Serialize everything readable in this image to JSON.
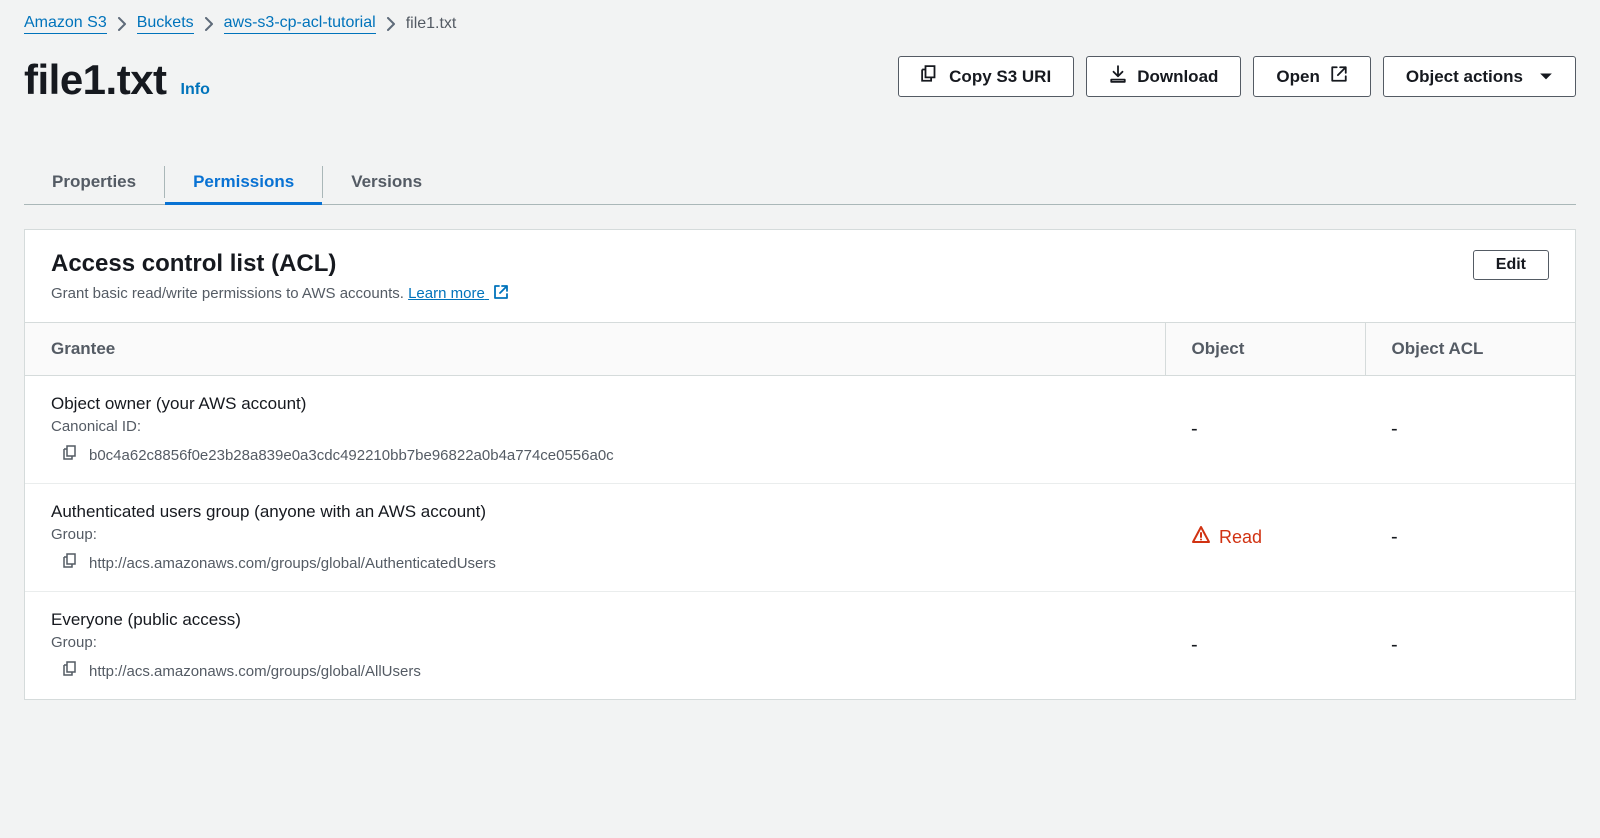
{
  "breadcrumb": {
    "items": [
      {
        "label": "Amazon S3",
        "href": true
      },
      {
        "label": "Buckets",
        "href": true
      },
      {
        "label": "aws-s3-cp-acl-tutorial",
        "href": true
      },
      {
        "label": "file1.txt",
        "href": false
      }
    ]
  },
  "header": {
    "title": "file1.txt",
    "info": "Info"
  },
  "actions": {
    "copy_uri": "Copy S3 URI",
    "download": "Download",
    "open": "Open",
    "object_actions": "Object actions"
  },
  "tabs": {
    "properties": "Properties",
    "permissions": "Permissions",
    "versions": "Versions",
    "active": "permissions"
  },
  "acl_panel": {
    "title": "Access control list (ACL)",
    "desc": "Grant basic read/write permissions to AWS accounts.",
    "learn_more": "Learn more",
    "edit": "Edit",
    "columns": {
      "grantee": "Grantee",
      "object": "Object",
      "object_acl": "Object ACL"
    },
    "rows": [
      {
        "title": "Object owner (your AWS account)",
        "sub": "Canonical ID:",
        "value": "b0c4a62c8856f0e23b28a839e0a3cdc492210bb7be96822a0b4a774ce0556a0c",
        "object": "-",
        "object_acl": "-"
      },
      {
        "title": "Authenticated users group (anyone with an AWS account)",
        "sub": "Group:",
        "value": "http://acs.amazonaws.com/groups/global/AuthenticatedUsers",
        "object": "Read",
        "object_warn": true,
        "object_acl": "-"
      },
      {
        "title": "Everyone (public access)",
        "sub": "Group:",
        "value": "http://acs.amazonaws.com/groups/global/AllUsers",
        "object": "-",
        "object_acl": "-"
      }
    ]
  }
}
